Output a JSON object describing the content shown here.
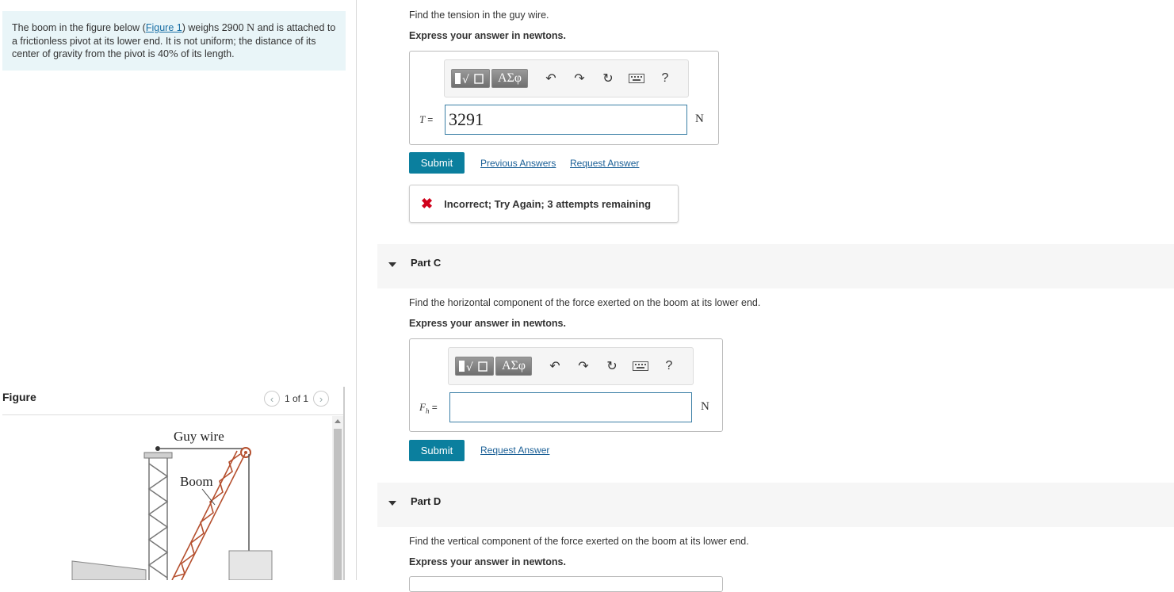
{
  "problem": {
    "text_1": "The boom in the figure below (",
    "figure_link": "Figure 1",
    "text_2": ") weighs 2900 ",
    "unit_N": "N",
    "text_3": " and is attached to a frictionless pivot at its lower end. It is not uniform; the distance of its center of gravity from the pivot is 40",
    "percent": "%",
    "text_4": " of its length."
  },
  "figure_panel": {
    "label": "Figure",
    "pager": "1 of 1",
    "guy_wire_label": "Guy wire",
    "boom_label": "Boom"
  },
  "part_b": {
    "question": "Find the tension in the guy wire.",
    "instruction": "Express your answer in newtons.",
    "toolbar_symbols": "ΑΣφ",
    "help": "?",
    "variable": "T",
    "equals": "=",
    "value": "3291",
    "unit": "N",
    "submit": "Submit",
    "previous_answers": "Previous Answers",
    "request_answer": "Request Answer",
    "feedback": "Incorrect; Try Again; 3 attempts remaining"
  },
  "part_c": {
    "title": "Part C",
    "question": "Find the horizontal component of the force exerted on the boom at its lower end.",
    "instruction": "Express your answer in newtons.",
    "toolbar_symbols": "ΑΣφ",
    "help": "?",
    "variable": "F",
    "subscript": "h",
    "equals": "=",
    "value": "",
    "unit": "N",
    "submit": "Submit",
    "request_answer": "Request Answer"
  },
  "part_d": {
    "title": "Part D",
    "question": "Find the vertical component of the force exerted on the boom at its lower end.",
    "instruction": "Express your answer in newtons."
  },
  "colors": {
    "accent": "#0b7f9e",
    "link": "#1a5f96",
    "problem_bg": "#e9f5f8",
    "error": "#d0021b"
  },
  "icons": [
    "templates-icon",
    "undo-icon",
    "redo-icon",
    "reset-icon",
    "keyboard-icon",
    "help-icon",
    "incorrect-x-icon",
    "chevron-left-icon",
    "chevron-right-icon",
    "collapse-triangle-icon"
  ]
}
